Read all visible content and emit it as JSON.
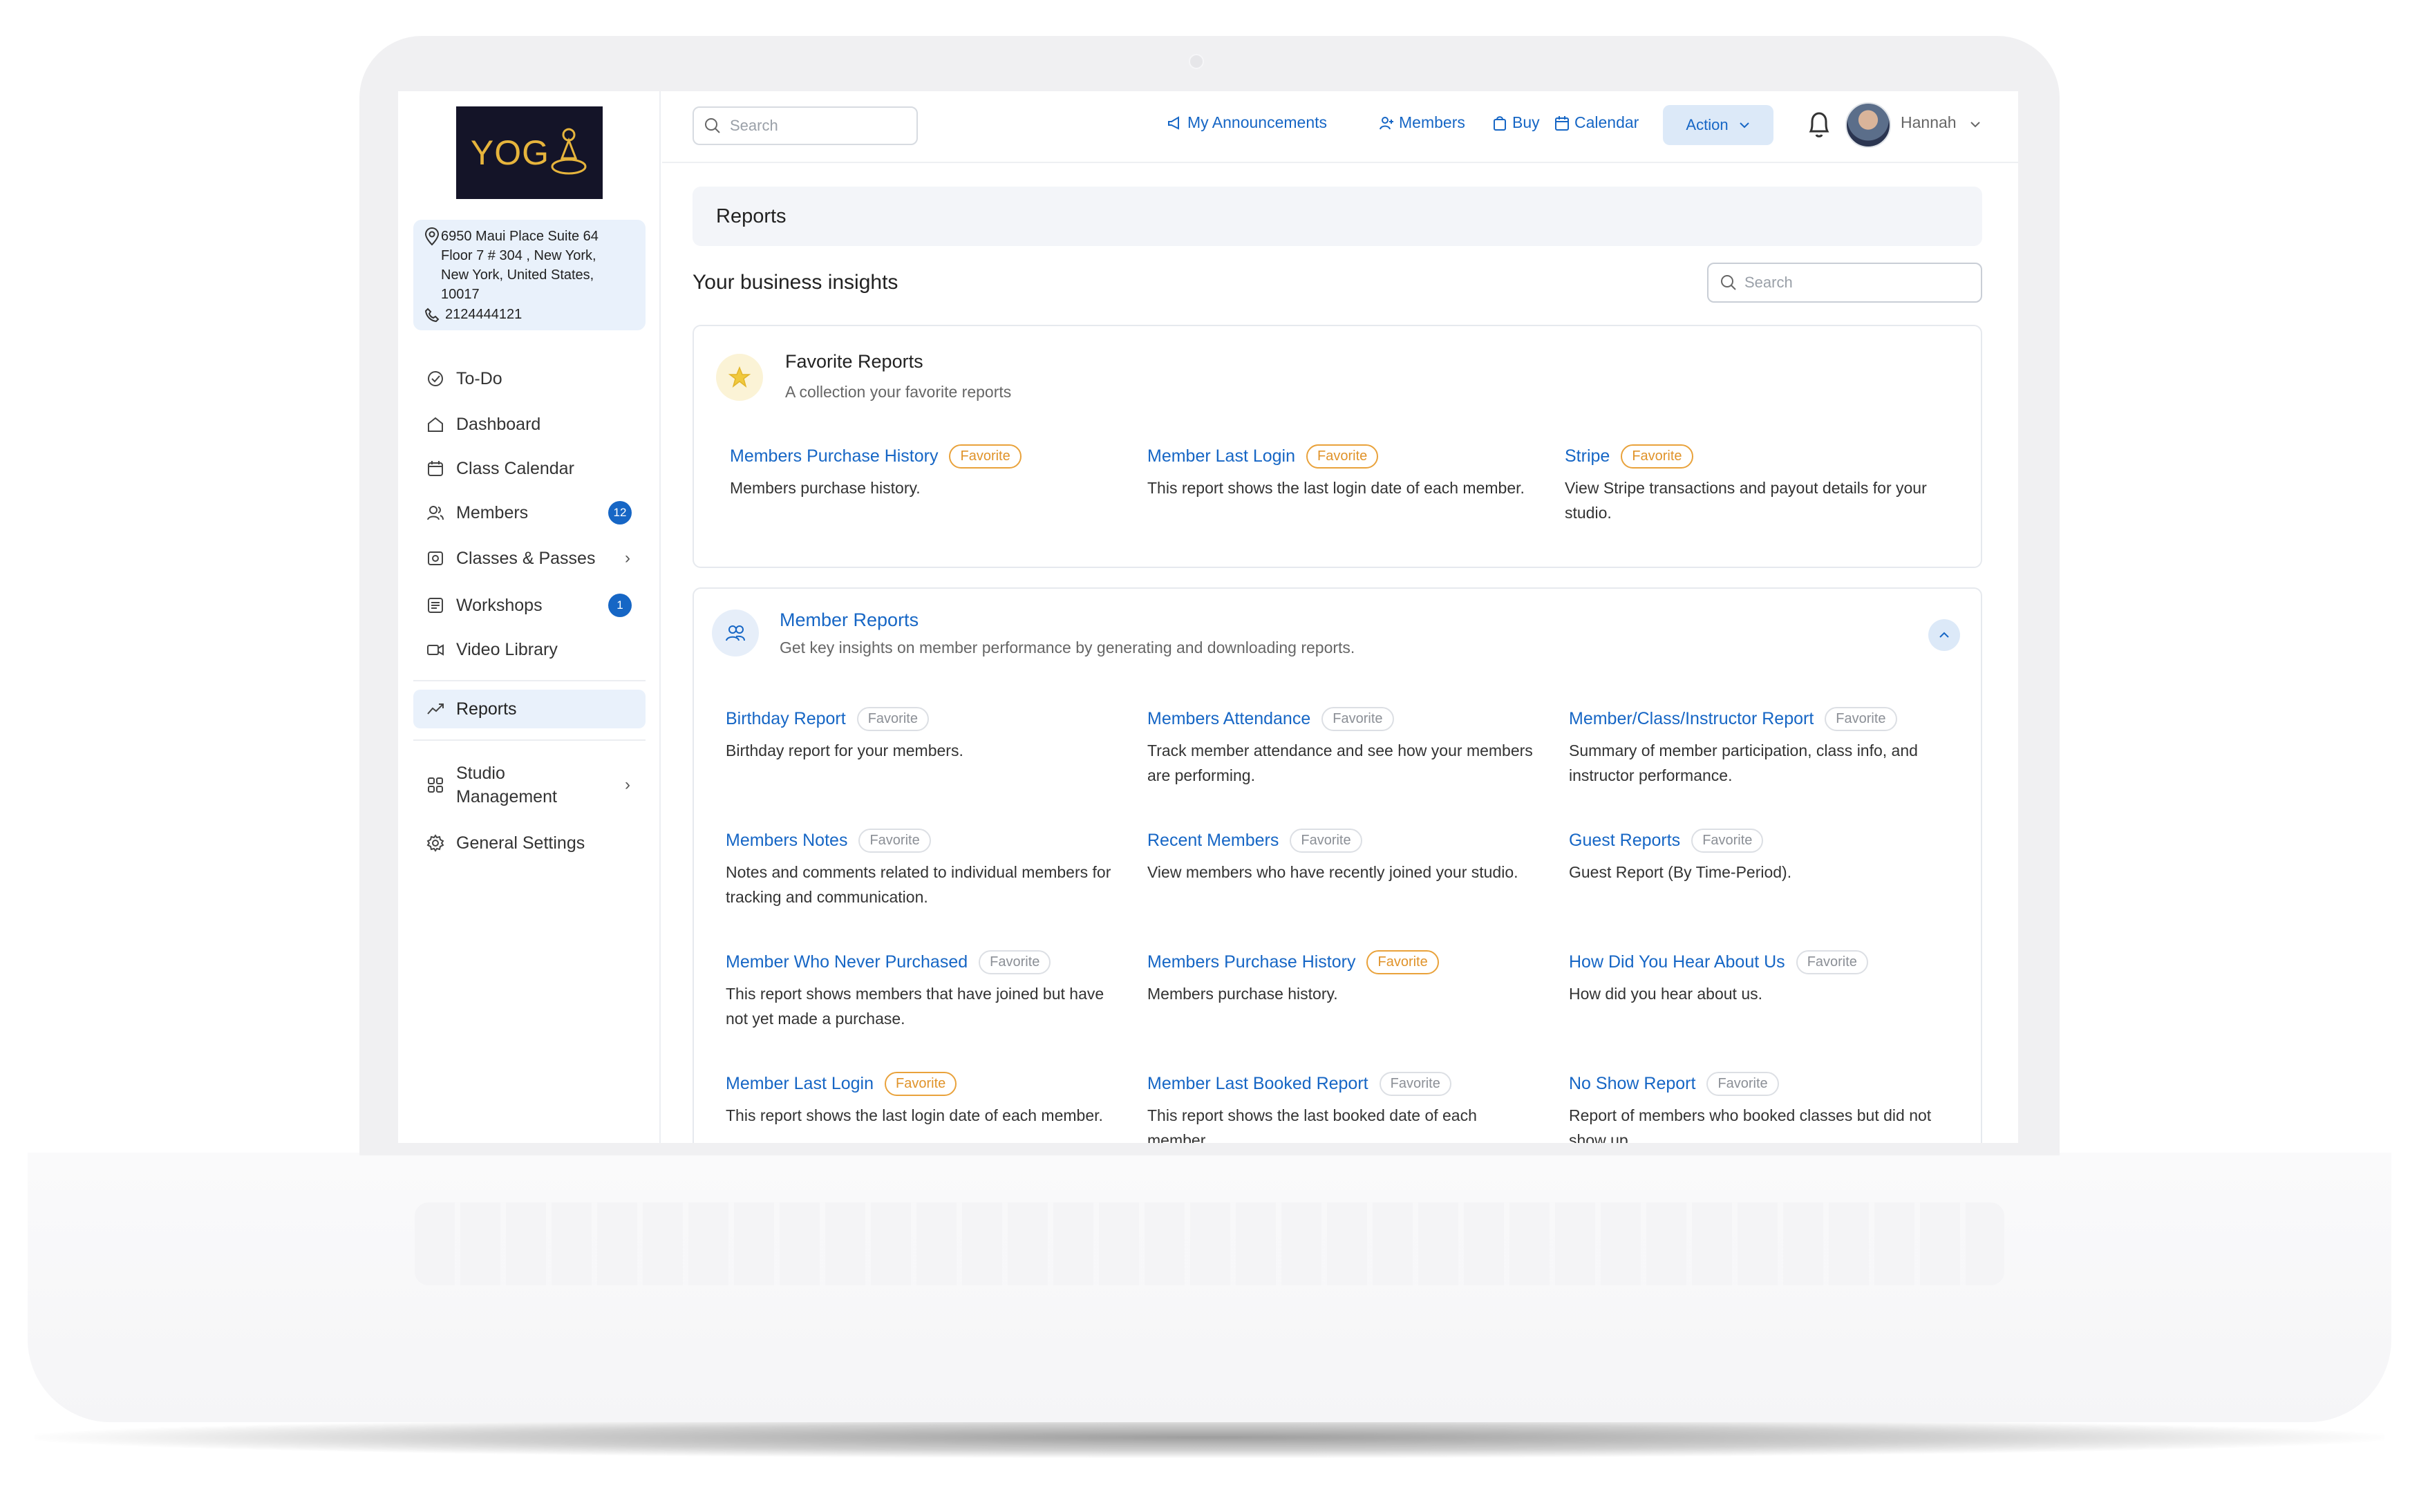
{
  "brand": {
    "logo_text": "YOG",
    "logo_color": "#e6b43c"
  },
  "studio": {
    "address": "6950 Maui Place Suite 64 Floor 7 # 304 , New York, New York, United States, 10017",
    "phone": "2124444121"
  },
  "sidebar": {
    "items": [
      {
        "label": "To-Do",
        "icon": "check-circle-icon"
      },
      {
        "label": "Dashboard",
        "icon": "home-icon"
      },
      {
        "label": "Class Calendar",
        "icon": "calendar-icon"
      },
      {
        "label": "Members",
        "icon": "users-icon",
        "badge": "12"
      },
      {
        "label": "Classes & Passes",
        "icon": "ticket-icon"
      },
      {
        "label": "Workshops",
        "icon": "workshop-icon",
        "badge": "1"
      },
      {
        "label": "Video Library",
        "icon": "video-icon"
      },
      {
        "label": "Reports",
        "icon": "trend-icon",
        "active": true
      },
      {
        "label": "Studio Management",
        "icon": "grid-icon"
      },
      {
        "label": "General Settings",
        "icon": "settings-icon"
      }
    ]
  },
  "topbar": {
    "search_placeholder": "Search",
    "links": [
      "My Announcements",
      "Members",
      "Buy",
      "Calendar"
    ],
    "action_label": "Action",
    "user_name": "Hannah"
  },
  "page": {
    "title": "Reports",
    "section_title": "Your business insights",
    "search_placeholder": "Search"
  },
  "favorites": {
    "title": "Favorite Reports",
    "subtitle": "A collection your favorite reports",
    "reports": [
      {
        "title": "Members Purchase History",
        "tag": "Favorite",
        "desc": "Members purchase history."
      },
      {
        "title": "Member Last Login",
        "tag": "Favorite",
        "desc": "This report shows the last login date of each member."
      },
      {
        "title": "Stripe",
        "tag": "Favorite",
        "desc": "View Stripe transactions and payout details for your studio."
      }
    ]
  },
  "member_reports": {
    "title": "Member Reports",
    "subtitle": "Get key insights on member performance by generating and downloading reports.",
    "reports": [
      {
        "title": "Birthday Report",
        "tag": "Favorite",
        "favorited": false,
        "desc": "Birthday report for your members."
      },
      {
        "title": "Members Attendance",
        "tag": "Favorite",
        "favorited": false,
        "desc": "Track member attendance and see how your members are performing."
      },
      {
        "title": "Member/Class/Instructor Report",
        "tag": "Favorite",
        "favorited": false,
        "desc": "Summary of member participation, class info, and instructor performance."
      },
      {
        "title": "Members Notes",
        "tag": "Favorite",
        "favorited": false,
        "desc": "Notes and comments related to individual members for tracking and communication."
      },
      {
        "title": "Recent Members",
        "tag": "Favorite",
        "favorited": false,
        "desc": "View members who have recently joined your studio."
      },
      {
        "title": "Guest Reports",
        "tag": "Favorite",
        "favorited": false,
        "desc": "Guest Report (By Time-Period)."
      },
      {
        "title": "Member Who Never Purchased",
        "tag": "Favorite",
        "favorited": false,
        "desc": "This report shows members that have joined but have not yet made a purchase."
      },
      {
        "title": "Members Purchase History",
        "tag": "Favorite",
        "favorited": true,
        "desc": "Members purchase history."
      },
      {
        "title": "How Did You Hear About Us",
        "tag": "Favorite",
        "favorited": false,
        "desc": "How did you hear about us."
      },
      {
        "title": "Member Last Login",
        "tag": "Favorite",
        "favorited": true,
        "desc": "This report shows the last login date of each member."
      },
      {
        "title": "Member Last Booked Report",
        "tag": "Favorite",
        "favorited": false,
        "desc": "This report shows the last booked date of each member."
      },
      {
        "title": "No Show Report",
        "tag": "Favorite",
        "favorited": false,
        "desc": "Report of members who booked classes but did not show up."
      }
    ]
  },
  "colors": {
    "accent": "#1666c5",
    "favorite": "#e0932a",
    "active_bg": "#e9f1fb"
  }
}
